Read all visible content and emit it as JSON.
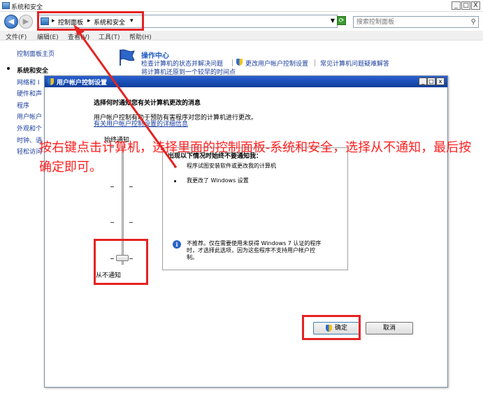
{
  "window": {
    "title": "系统和安全",
    "min": "_",
    "max": "□",
    "close": "X"
  },
  "address": {
    "crumb1": "控制面板",
    "crumb2": "系统和安全",
    "search_placeholder": "搜索控制面板"
  },
  "menu": [
    "文件(F)",
    "编辑(E)",
    "查看(V)",
    "工具(T)",
    "帮助(H)"
  ],
  "left_nav": {
    "home": "控制面板主页",
    "current": "系统和安全",
    "items": [
      "网络和 I",
      "硬件和声",
      "程序",
      "用户帐户",
      "外观和个",
      "时钟、语",
      "轻松访问"
    ]
  },
  "action_center": {
    "title": "操作中心",
    "link1": "检查计算机的状态并解决问题",
    "link2": "更改用户帐户控制设置",
    "link3": "常见计算机问题疑难解答",
    "link4": "将计算机还原到一个较早的时间点"
  },
  "uac": {
    "title": "用户帐户控制设置",
    "heading": "选择何时通知您有关计算机更改的消息",
    "desc": "用户帐户控制有助于预防有害程序对您的计算机进行更改。",
    "link": "有关用户帐户控制设置的详细信息",
    "top_label": "始终通知",
    "bottom_label": "从不通知",
    "slider_level": 0,
    "slider_levels": 4,
    "info_title": "出现以下情况时始终不要通知我：",
    "info_items": [
      "程序试图安装软件或更改我的计算机",
      "我更改了 Windows 设置"
    ],
    "warning": [
      "不推荐。仅在需要使用未获得 Windows 7 认证的程序",
      "时，才选择此选项，因为这些程序不支持用户帐户控",
      "制。"
    ],
    "ok": "确定",
    "cancel": "取消"
  },
  "annotation": {
    "text": "按右键点击计算机，选择里面的控制面板-系统和安全，选择从不通知，最后按确定即可。",
    "color": "#e52222"
  }
}
